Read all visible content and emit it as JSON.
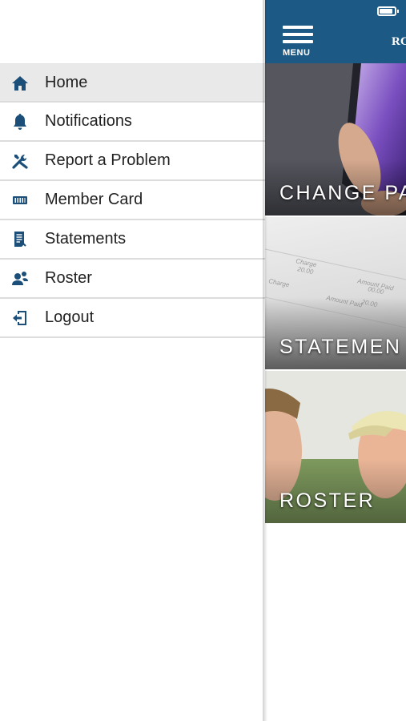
{
  "colors": {
    "brand": "#1d5985",
    "icon": "#1b4f7a",
    "active_row": "#e9e9e9",
    "divider": "#dcdcdc"
  },
  "header": {
    "menu_label": "MENU",
    "title": "RC"
  },
  "drawer": {
    "items": [
      {
        "label": "Home",
        "icon": "home-icon",
        "active": true
      },
      {
        "label": "Notifications",
        "icon": "bell-icon",
        "active": false
      },
      {
        "label": "Report a Problem",
        "icon": "tools-icon",
        "active": false
      },
      {
        "label": "Member Card",
        "icon": "card-icon",
        "active": false
      },
      {
        "label": "Statements",
        "icon": "document-icon",
        "active": false
      },
      {
        "label": "Roster",
        "icon": "people-icon",
        "active": false
      },
      {
        "label": "Logout",
        "icon": "logout-icon",
        "active": false
      }
    ]
  },
  "tiles": [
    {
      "label": "CHANGE PA"
    },
    {
      "label": "STATEMEN"
    },
    {
      "label": "ROSTER"
    }
  ]
}
